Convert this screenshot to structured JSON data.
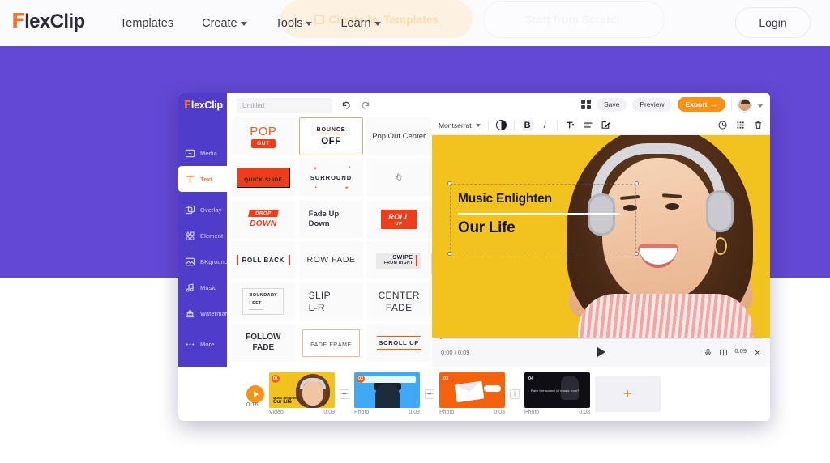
{
  "site": {
    "brand_prefix": "F",
    "brand_rest": "lexClip",
    "accent_orange": "#f4762a",
    "purple": "#6248d4",
    "nav": [
      {
        "label": "Templates",
        "has_caret": false
      },
      {
        "label": "Create",
        "has_caret": true
      },
      {
        "label": "Tools",
        "has_caret": true
      },
      {
        "label": "Learn",
        "has_caret": true
      }
    ],
    "ghost_buttons": [
      {
        "label": "Create by Templates",
        "style": "filled-faded"
      },
      {
        "label": "Start from Scratch",
        "style": "outline-faded"
      }
    ],
    "login_label": "Login"
  },
  "editor": {
    "brand_prefix": "F",
    "brand_rest": "lexClip",
    "project_title_placeholder": "Untitled",
    "undo_icon": "undo-icon",
    "redo_icon": "redo-icon",
    "sidebar": [
      {
        "label": "Media",
        "icon": "media-icon",
        "active": false
      },
      {
        "label": "Text",
        "icon": "text-icon",
        "active": true
      },
      {
        "label": "Overlay",
        "icon": "overlay-icon",
        "active": false
      },
      {
        "label": "Element",
        "icon": "element-icon",
        "active": false
      },
      {
        "label": "BKground",
        "icon": "background-icon",
        "active": false
      },
      {
        "label": "Music",
        "icon": "music-icon",
        "active": false
      },
      {
        "label": "Watermark",
        "icon": "watermark-icon",
        "active": false
      },
      {
        "label": "More",
        "icon": "more-icon",
        "active": false
      }
    ],
    "animations": [
      {
        "id": "pop-out",
        "kind": "pop",
        "title": "POP",
        "chip": "OUT",
        "selected": false
      },
      {
        "id": "bounce-off",
        "kind": "bounce",
        "title": "BOUNCE",
        "sub": "OFF",
        "selected": true
      },
      {
        "id": "pop-out-center",
        "kind": "plain",
        "title": "Pop Out Center",
        "selected": false
      },
      {
        "id": "quick-slide",
        "kind": "quickslide",
        "title": "QUICK SLIDE",
        "selected": false
      },
      {
        "id": "surround",
        "kind": "surround",
        "title": "SURROUND",
        "selected": false
      },
      {
        "id": "hand-cursor",
        "kind": "hand",
        "title": "",
        "selected": false
      },
      {
        "id": "drop-down",
        "kind": "drop",
        "title": "DROP",
        "sub": "DOWN",
        "selected": false
      },
      {
        "id": "fade-up-down",
        "kind": "bold2",
        "title": "Fade Up",
        "sub": "Down",
        "selected": false
      },
      {
        "id": "roll-up",
        "kind": "rollbox",
        "title": "ROLL",
        "sub": "UP",
        "selected": false
      },
      {
        "id": "roll-back",
        "kind": "rollback",
        "title": "ROLL BACK",
        "selected": false
      },
      {
        "id": "row-fade",
        "kind": "plain",
        "title": "ROW FADE",
        "selected": false
      },
      {
        "id": "swipe-right",
        "kind": "swipe",
        "title": "SWIPE",
        "sub": "FROM RIGHT",
        "selected": false
      },
      {
        "id": "boundary-left",
        "kind": "boundary",
        "title": "BOUNDARY",
        "sub": "LEFT",
        "selected": false
      },
      {
        "id": "slip-lr",
        "kind": "slip",
        "title": "SLIP",
        "sub": "L-R",
        "selected": false
      },
      {
        "id": "center-fade",
        "kind": "slip",
        "title": "CENTER",
        "sub": "FADE",
        "selected": false
      },
      {
        "id": "follow-fade",
        "kind": "bold2c",
        "title": "FOLLOW",
        "sub": "FADE",
        "selected": false
      },
      {
        "id": "fade-frame",
        "kind": "fadeframe",
        "title": "FADE FRAME",
        "selected": false
      },
      {
        "id": "scroll-up",
        "kind": "scrollup",
        "title": "SCROLL UP",
        "selected": false
      }
    ],
    "topbar": {
      "fullscreen_icon": "fullscreen-grid-icon",
      "save_label": "Save",
      "preview_label": "Preview",
      "export_label": "Export",
      "export_arrow": "→",
      "avatar_icon": "avatar",
      "avatar_caret_icon": "chevron-down-icon"
    },
    "format_bar": {
      "font_name": "Montserrat",
      "contrast_icon": "contrast-icon",
      "bold_label": "B",
      "italic_label": "I",
      "text_color_icon": "text-color-icon",
      "align_icon": "align-left-icon",
      "edit_icon": "edit-icon",
      "timer_icon": "timer-icon",
      "apps_icon": "apps-grid-icon",
      "delete_icon": "trash-icon"
    },
    "canvas": {
      "caption_line1": "Music Enlighten",
      "caption_line2": "Our Life",
      "background_color": "#f2c21f"
    },
    "player": {
      "time_current": "0:00",
      "time_total": "0:09",
      "time_display": "0:00 / 0:09",
      "play_icon": "play-icon",
      "mic_icon": "microphone-icon",
      "subtitle_icon": "subtitle-icon",
      "duration_label": "0:09",
      "close_icon": "close-icon"
    },
    "timeline": {
      "play_icon": "play-icon",
      "total_duration": "0:16",
      "add_label": "+",
      "clips": [
        {
          "num": "01",
          "type": "Video",
          "duration": "0:09",
          "thumb_class": "c1"
        },
        {
          "num": "02",
          "type": "Photo",
          "duration": "0:03",
          "thumb_class": "c2"
        },
        {
          "num": "03",
          "type": "Photo",
          "duration": "0:03",
          "thumb_class": "c3"
        },
        {
          "num": "04",
          "type": "Photo",
          "duration": "0:03",
          "thumb_class": "c4"
        }
      ]
    }
  }
}
